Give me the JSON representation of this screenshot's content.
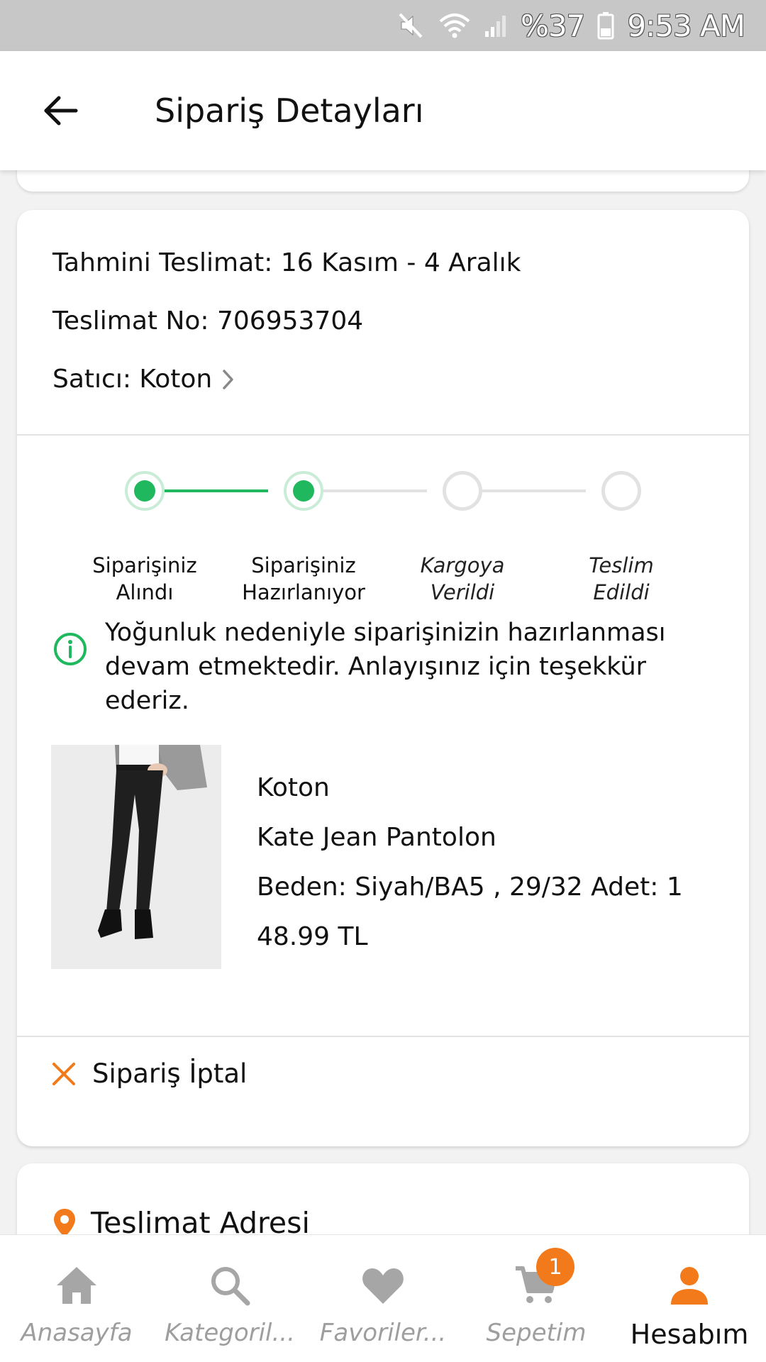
{
  "status_bar": {
    "battery_percent": "%37",
    "time": "9:53 AM",
    "icons": [
      "mute-icon",
      "wifi-icon",
      "signal-icon",
      "battery-icon"
    ]
  },
  "app_bar": {
    "title": "Sipariş Detayları",
    "back_icon": "arrow-left-icon"
  },
  "order": {
    "estimated_delivery": "Tahmini Teslimat: 16 Kasım - 4 Aralık",
    "delivery_no": "Teslimat No: 706953704",
    "seller": "Satıcı: Koton"
  },
  "stepper": {
    "steps": [
      {
        "line1": "Siparişiniz",
        "line2": "Alındı",
        "done": true
      },
      {
        "line1": "Siparişiniz",
        "line2": "Hazırlanıyor",
        "done": true
      },
      {
        "line1": "Kargoya",
        "line2": "Verildi",
        "done": false
      },
      {
        "line1": "Teslim",
        "line2": "Edildi",
        "done": false
      }
    ]
  },
  "notice": {
    "text": "Yoğunluk nedeniyle siparişinizin hazırlanması devam etmektedir. Anlayışınız için teşekkür ederiz."
  },
  "product": {
    "brand": "Koton",
    "name": "Kate Jean Pantolon",
    "variant": "Beden: Siyah/BA5 , 29/32  Adet: 1",
    "price": "48.99 TL"
  },
  "actions": {
    "cancel_label": "Sipariş İptal"
  },
  "address": {
    "title": "Teslimat Adresi"
  },
  "bottom_nav": {
    "items": [
      {
        "label": "Anasayfa",
        "icon": "home-icon"
      },
      {
        "label": "Kategoril...",
        "icon": "search-icon"
      },
      {
        "label": "Favoriler...",
        "icon": "heart-icon"
      },
      {
        "label": "Sepetim",
        "icon": "cart-icon",
        "badge": "1"
      },
      {
        "label": "Hesabım",
        "icon": "user-icon",
        "active": true
      }
    ]
  },
  "colors": {
    "accent": "#f27a1a",
    "success": "#1fb85e",
    "inactive": "#9e9e9e"
  }
}
